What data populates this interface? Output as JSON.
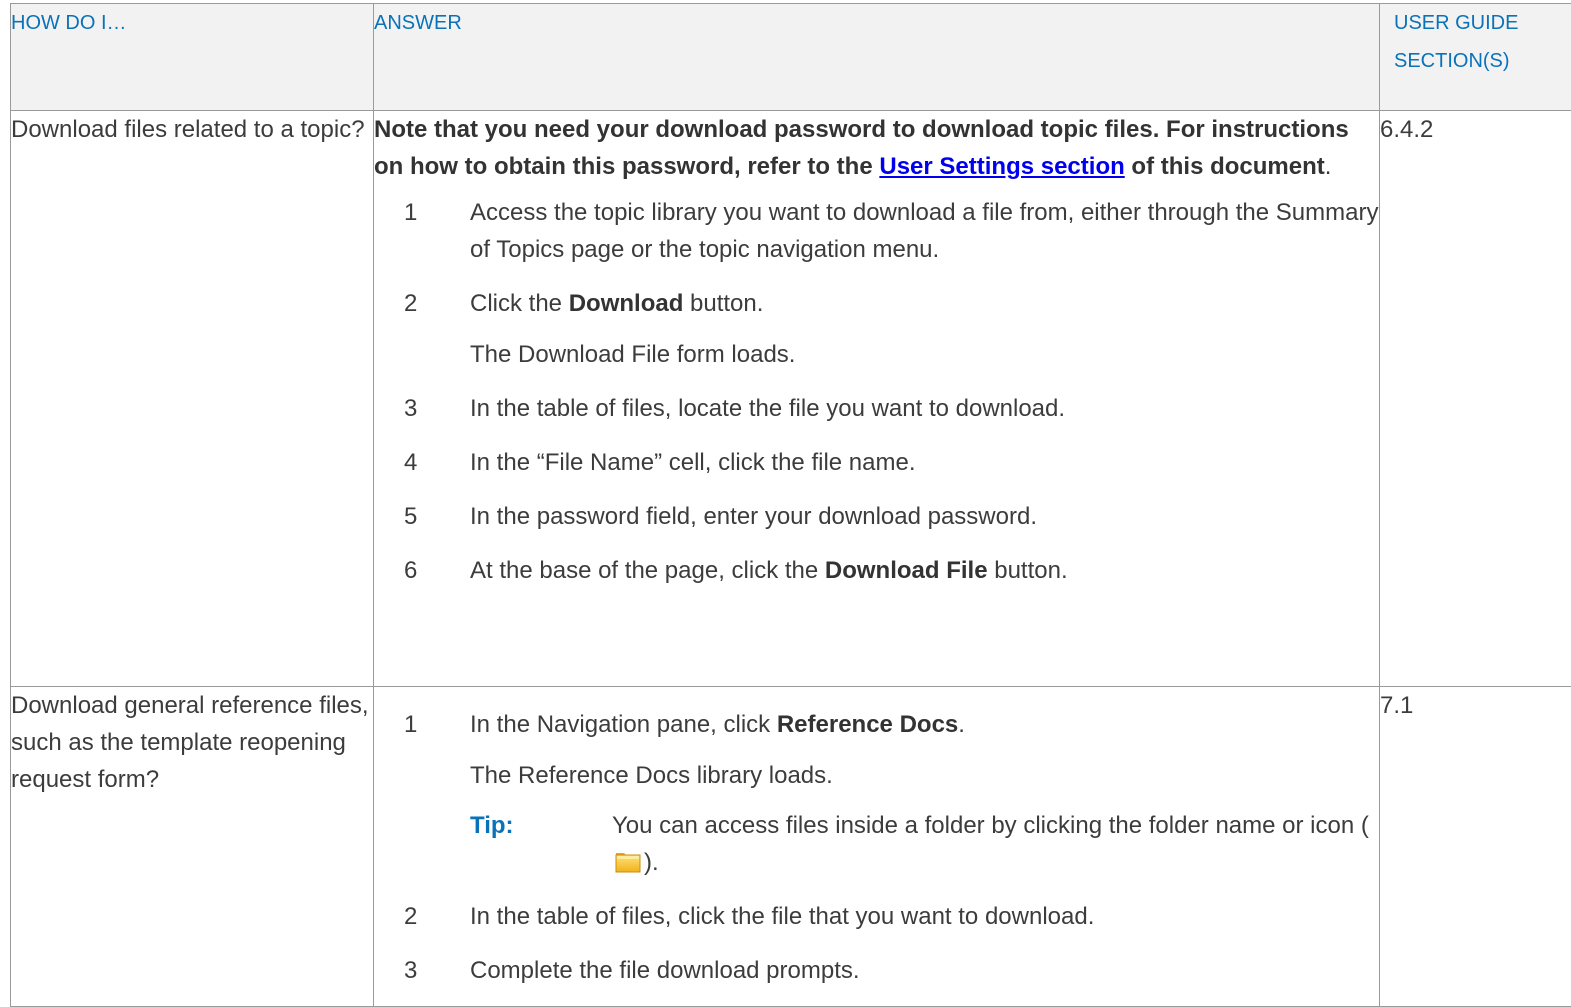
{
  "headers": {
    "how": "HOW DO I…",
    "answer": "ANSWER",
    "section": "USER GUIDE SECTION(S)"
  },
  "rows": [
    {
      "question": "Download files related to a topic?",
      "note": {
        "bold_before": "Note that you need your download password to download topic files. For instructions on how to obtain this password, refer to the ",
        "link": "User Settings section",
        "bold_after": " of this document",
        "end": "."
      },
      "steps": [
        {
          "num": "1",
          "text": "Access the topic library you want to download a file from, either through the Summary of Topics page or the topic navigation menu."
        },
        {
          "num": "2",
          "before": "Click the ",
          "bold": "Download",
          "after": " button.",
          "sub": "The Download File form loads."
        },
        {
          "num": "3",
          "text": "In the table of files, locate the file you want to download."
        },
        {
          "num": "4",
          "text": "In the “File Name” cell, click the file name."
        },
        {
          "num": "5",
          "text": "In the password field, enter your download password."
        },
        {
          "num": "6",
          "before": "At the base of the page, click the ",
          "bold": "Download File",
          "after": " button."
        }
      ],
      "section": "6.4.2"
    },
    {
      "question": "Download general reference files, such as the template reopening request form?",
      "steps": [
        {
          "num": "1",
          "before": "In the Navigation pane, click ",
          "bold": "Reference Docs",
          "after": ".",
          "sub": "The Reference Docs library loads."
        },
        {
          "num": "2",
          "text": "In the table of files, click the file that you want to download."
        },
        {
          "num": "3",
          "text": "Complete the file download prompts."
        }
      ],
      "tip": {
        "label": "Tip:",
        "before": "You can access files inside a folder by clicking the folder name or icon (",
        "icon": "folder-icon",
        "after": ")."
      },
      "section": "7.1"
    }
  ],
  "colors": {
    "header_text": "#0a72b9",
    "header_bg": "#f2f2f2",
    "link": "#0000ee",
    "border": "#9a9a9a"
  }
}
